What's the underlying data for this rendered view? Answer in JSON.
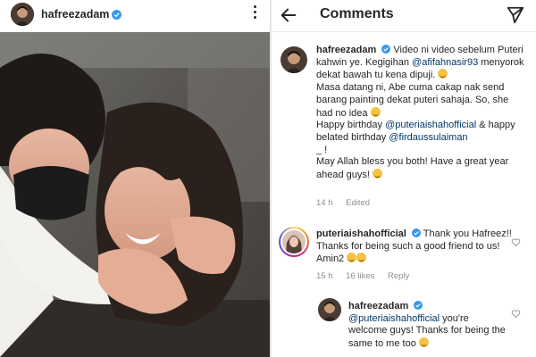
{
  "post": {
    "username": "hafreezadam",
    "verified": true,
    "more_icon": "more-vertical-icon"
  },
  "comments_screen": {
    "title": "Comments",
    "back_icon": "back-arrow-icon",
    "share_icon": "send-icon"
  },
  "caption": {
    "username": "hafreezadam",
    "verified": true,
    "text_1": "Video ni video sebelum Puteri kahwin ye. Kegigihan",
    "mention_1": "@afifahnasir93",
    "text_2": "menyorok dekat bawah tu kena dipuji.",
    "text_3": "Masa datang ni, Abe cuma cakap nak send barang painting dekat puteri sahaja. So, she had no idea",
    "text_4": "Happy birthday",
    "mention_2": "@puteriaishahofficial",
    "text_5": "& happy belated birthday",
    "mention_3": "@firdaussulaiman",
    "text_6": "_ !",
    "text_7": "May Allah bless you both! Have a great year ahead guys!",
    "time": "14 h",
    "edited": "Edited"
  },
  "comment_1": {
    "username": "puteriaishahofficial",
    "verified": true,
    "text": "Thank you Hafreez!! Thanks for being such a good friend to us! Amin2",
    "time": "15 h",
    "likes": "16 likes",
    "reply": "Reply"
  },
  "comment_2": {
    "username": "hafreezadam",
    "verified": true,
    "mention": "@puteriaishahofficial",
    "text": "you're welcome guys! Thanks for being the same to me too"
  },
  "colors": {
    "verified_blue": "#3897f0",
    "mention_blue": "#00376b",
    "meta_gray": "#8e8e8e"
  }
}
